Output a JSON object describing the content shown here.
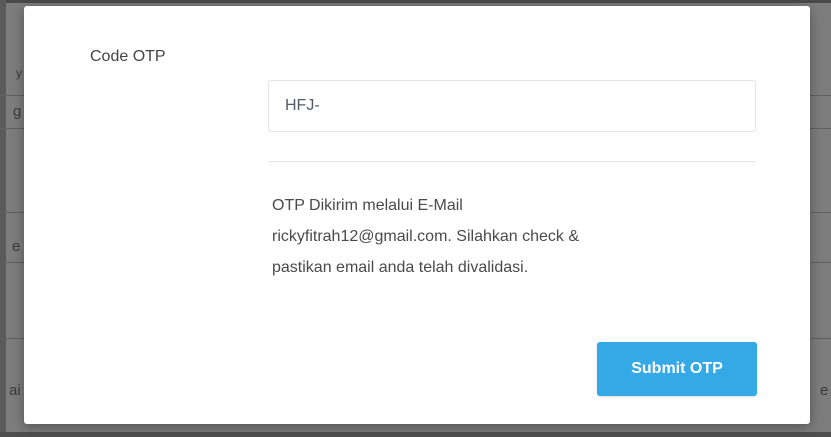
{
  "background": {
    "left_fragments": [
      "y",
      "g",
      "e",
      "ai"
    ],
    "right_fragments": [
      "e"
    ]
  },
  "modal": {
    "otp_label": "Code OTP",
    "otp_value": "HFJ-",
    "info_lines": [
      "OTP Dikirim melalui E-Mail",
      "rickyfitrah12@gmail.com. Silahkan check &",
      "pastikan email anda telah divalidasi."
    ],
    "submit_label": "Submit OTP"
  },
  "colors": {
    "accent": "#35a9e6",
    "overlay": "#7d7d7d",
    "text": "#4a4a4a"
  }
}
